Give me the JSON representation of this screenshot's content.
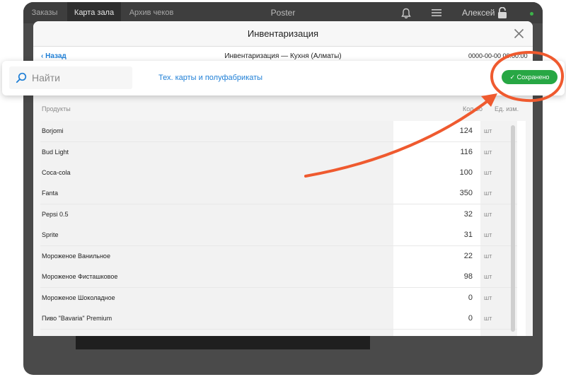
{
  "topbar": {
    "tabs": [
      "Заказы",
      "Карта зала",
      "Архив чеков"
    ],
    "active_tab": 1,
    "app_title": "Poster",
    "user_name": "Алексей"
  },
  "modal": {
    "title": "Инвентаризация",
    "back_label": "Назад",
    "subtitle": "Инвентаризация — Кухня (Алматы)",
    "date": "0000-00-00 00:00:00"
  },
  "toolbar": {
    "search_placeholder": "Найти",
    "link_label": "Тех. карты и полуфабрикаты",
    "saved_label": "✓ Сохранено"
  },
  "table": {
    "columns": {
      "product": "Продукты",
      "quantity": "Кол-во",
      "unit": "Ед. изм."
    },
    "rows": [
      {
        "name": "Borjomi",
        "qty": "124",
        "unit": "шт"
      },
      {
        "name": "Bud Light",
        "qty": "116",
        "unit": "шт"
      },
      {
        "name": "Coca-cola",
        "qty": "100",
        "unit": "шт"
      },
      {
        "name": "Fanta",
        "qty": "350",
        "unit": "шт"
      },
      {
        "name": "Pepsi 0.5",
        "qty": "32",
        "unit": "шт"
      },
      {
        "name": "Sprite",
        "qty": "31",
        "unit": "шт"
      },
      {
        "name": "Мороженое Ванильное",
        "qty": "22",
        "unit": "шт"
      },
      {
        "name": "Мороженое Фисташковое",
        "qty": "98",
        "unit": "шт"
      },
      {
        "name": "Мороженое Шоколадное",
        "qty": "0",
        "unit": "шт"
      },
      {
        "name": "Пиво \"Bavaria\" Premium",
        "qty": "0",
        "unit": "шт"
      },
      {
        "name": "",
        "qty": "",
        "unit": ""
      }
    ]
  },
  "icons": {
    "back": "chevron-left-icon",
    "close": "close-icon",
    "search": "search-icon",
    "bell": "bell-icon",
    "menu": "menu-icon",
    "lock": "lock-icon"
  },
  "colors": {
    "accent": "#1f7fd6",
    "saved": "#27a744",
    "annotation": "#ef5a2f"
  }
}
